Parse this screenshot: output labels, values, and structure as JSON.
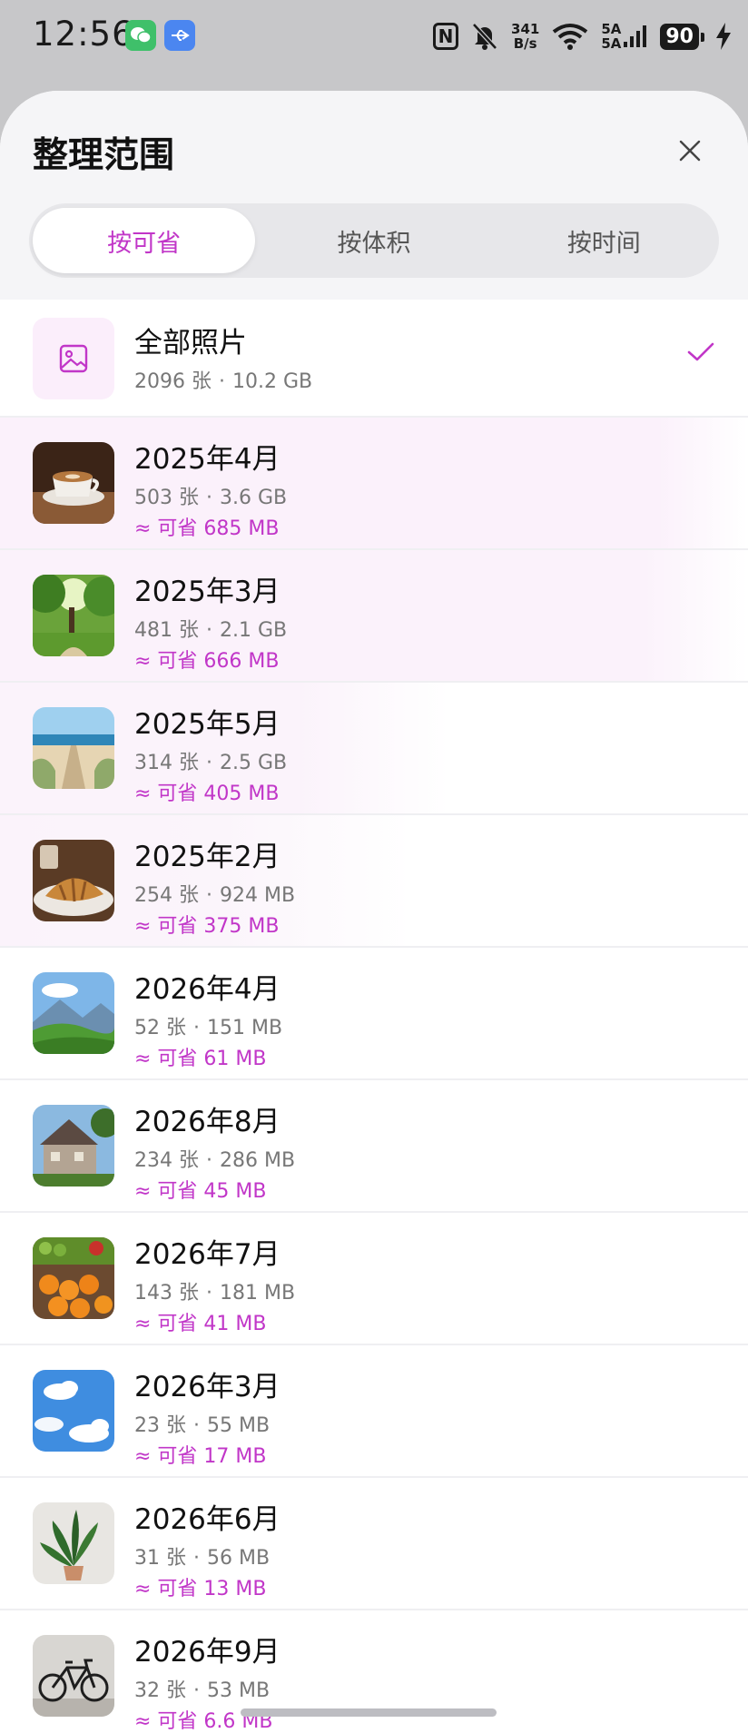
{
  "status_bar": {
    "time": "12:56",
    "net_speed_value": "341",
    "net_speed_unit": "B/s",
    "signal_1": "5A",
    "signal_2": "5A",
    "battery": "90",
    "icons": [
      "wechat-icon",
      "usb-icon",
      "nfc-icon",
      "mute-icon",
      "wifi-icon",
      "signal-icon",
      "battery-icon",
      "charging-icon"
    ]
  },
  "sheet": {
    "title": "整理范围",
    "tabs": [
      {
        "label": "按可省",
        "active": true
      },
      {
        "label": "按体积",
        "active": false
      },
      {
        "label": "按时间",
        "active": false
      }
    ]
  },
  "all_photos": {
    "title": "全部照片",
    "count": "2096 张",
    "size": "10.2 GB",
    "selected": true
  },
  "items": [
    {
      "title": "2025年4月",
      "count": "503 张",
      "size": "3.6 GB",
      "save": "≈ 可省 685 MB",
      "thumb": "coffee-thumbnail"
    },
    {
      "title": "2025年3月",
      "count": "481 张",
      "size": "2.1 GB",
      "save": "≈ 可省 666 MB",
      "thumb": "park-thumbnail"
    },
    {
      "title": "2025年5月",
      "count": "314 张",
      "size": "2.5 GB",
      "save": "≈ 可省 405 MB",
      "thumb": "beach-thumbnail"
    },
    {
      "title": "2025年2月",
      "count": "254 张",
      "size": "924 MB",
      "save": "≈ 可省 375 MB",
      "thumb": "croissant-thumbnail"
    },
    {
      "title": "2026年4月",
      "count": "52 张",
      "size": "151 MB",
      "save": "≈ 可省 61 MB",
      "thumb": "hills-thumbnail"
    },
    {
      "title": "2026年8月",
      "count": "234 张",
      "size": "286 MB",
      "save": "≈ 可省 45 MB",
      "thumb": "house-thumbnail"
    },
    {
      "title": "2026年7月",
      "count": "143 张",
      "size": "181 MB",
      "save": "≈ 可省 41 MB",
      "thumb": "fruit-thumbnail"
    },
    {
      "title": "2026年3月",
      "count": "23 张",
      "size": "55 MB",
      "save": "≈ 可省 17 MB",
      "thumb": "sky-thumbnail"
    },
    {
      "title": "2026年6月",
      "count": "31 张",
      "size": "56 MB",
      "save": "≈ 可省 13 MB",
      "thumb": "plant-thumbnail"
    },
    {
      "title": "2026年9月",
      "count": "32 张",
      "size": "53 MB",
      "save": "≈ 可省 6.6 MB",
      "thumb": "bicycle-thumbnail"
    }
  ],
  "colors": {
    "accent": "#c136c8",
    "highlight": "#fbf1fb",
    "backdrop": "#c7c7c9"
  }
}
